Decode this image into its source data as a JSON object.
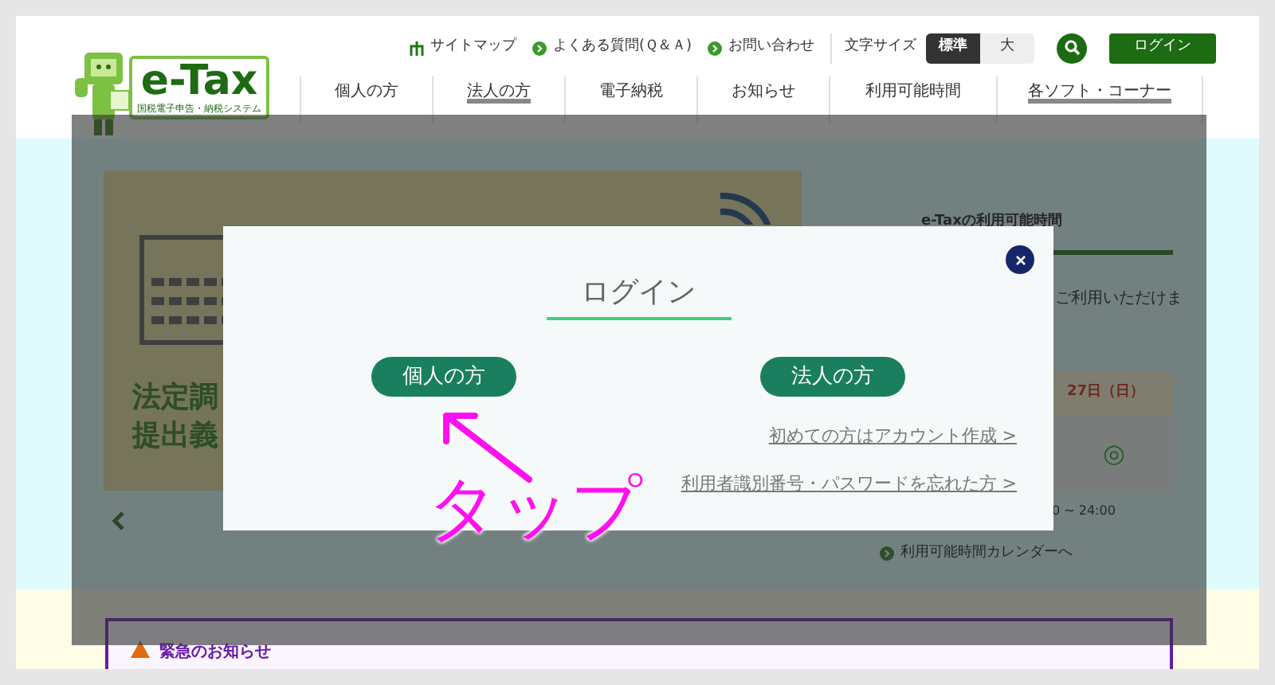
{
  "header": {
    "logo": {
      "title": "e-Tax",
      "subtitle": "国税電子申告・納税システム"
    },
    "utility_links": [
      {
        "label": "サイトマップ",
        "kind": "sitemap"
      },
      {
        "label": "よくある質問(Ｑ＆Ａ)",
        "kind": "arrow"
      },
      {
        "label": "お問い合わせ",
        "kind": "arrow"
      }
    ],
    "font_size": {
      "label": "文字サイズ",
      "options": [
        {
          "label": "標準",
          "selected": true
        },
        {
          "label": "大",
          "selected": false
        }
      ]
    },
    "login_button": "ログイン"
  },
  "nav": [
    {
      "label": "個人の方",
      "selected": false
    },
    {
      "label": "法人の方",
      "selected": true
    },
    {
      "label": "電子納税",
      "selected": false
    },
    {
      "label": "お知らせ",
      "selected": false
    },
    {
      "label": "利用可能時間",
      "selected": false
    },
    {
      "label": "各ソフト・コーナー",
      "selected": true
    }
  ],
  "banner": {
    "lines": [
      "法定調",
      "提出義"
    ]
  },
  "availability": {
    "title": "e-Taxの利用可能時間",
    "text": "ご利用いただけま",
    "day": "27日（日）",
    "mark": "◎",
    "hours": "0 ~ 24:00",
    "calendar_link": "利用可能時間カレンダーへ"
  },
  "notice": {
    "title": "緊急のお知らせ"
  },
  "modal": {
    "title": "ログイン",
    "buttons": [
      "個人の方",
      "法人の方"
    ],
    "links": [
      "初めての方はアカウント作成 >",
      "利用者識別番号・パスワードを忘れた方 >"
    ]
  },
  "annotation": {
    "text": "タップ"
  }
}
